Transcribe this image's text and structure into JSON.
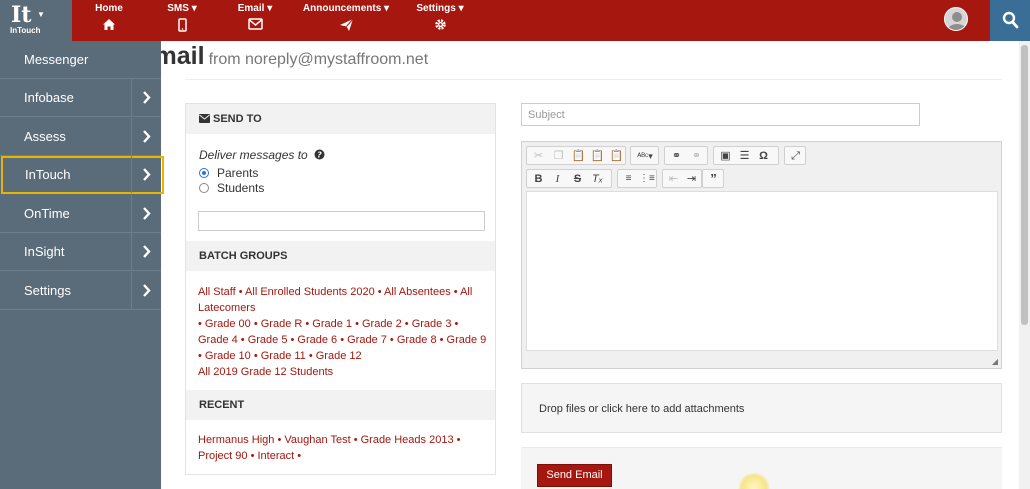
{
  "app": {
    "logo_text": "It",
    "logo_sub": "InTouch"
  },
  "nav": [
    {
      "label": "Home",
      "icon": "home-icon"
    },
    {
      "label": "SMS ▾",
      "icon": "mobile-icon"
    },
    {
      "label": "Email ▾",
      "icon": "envelope-icon"
    },
    {
      "label": "Announcements ▾",
      "icon": "paper-plane-icon"
    },
    {
      "label": "Settings ▾",
      "icon": "gear-icon"
    }
  ],
  "page": {
    "title": "Compose Email",
    "from": "from noreply@mystaffroom.net"
  },
  "sidebar": {
    "items": [
      {
        "label": "Messenger",
        "has_arrow": false
      },
      {
        "label": "Infobase",
        "has_arrow": true
      },
      {
        "label": "Assess",
        "has_arrow": true
      },
      {
        "label": "InTouch",
        "has_arrow": true,
        "highlighted": true
      },
      {
        "label": "OnTime",
        "has_arrow": true
      },
      {
        "label": "InSight",
        "has_arrow": true
      },
      {
        "label": "Settings",
        "has_arrow": true
      }
    ]
  },
  "send_to": {
    "heading": "SEND TO",
    "deliver_label": "Deliver messages to",
    "options": [
      {
        "label": "Parents",
        "selected": true
      },
      {
        "label": "Students",
        "selected": false
      }
    ],
    "filter_value": ""
  },
  "batch_groups": {
    "heading": "BATCH GROUPS",
    "lines": [
      "All Staff • All Enrolled Students 2020 • All Absentees • All Latecomers",
      "• Grade 00 • Grade R • Grade 1 • Grade 2 • Grade 3 • Grade 4 • Grade 5 • Grade 6 • Grade 7 • Grade 8 • Grade 9 • Grade 10 • Grade 11 • Grade 12",
      "All 2019 Grade 12 Students"
    ]
  },
  "recent": {
    "heading": "RECENT",
    "text": "Hermanus High • Vaughan Test • Grade Heads 2013 • Project 90 • Interact •"
  },
  "compose": {
    "subject_placeholder": "Subject",
    "dropzone_text": "Drop files or click here to add attachments",
    "send_label": "Send Email"
  },
  "colors": {
    "primary": "#a5170f",
    "sidebar": "#5a6b79",
    "search": "#3a6e97",
    "highlight": "#e8b400"
  }
}
